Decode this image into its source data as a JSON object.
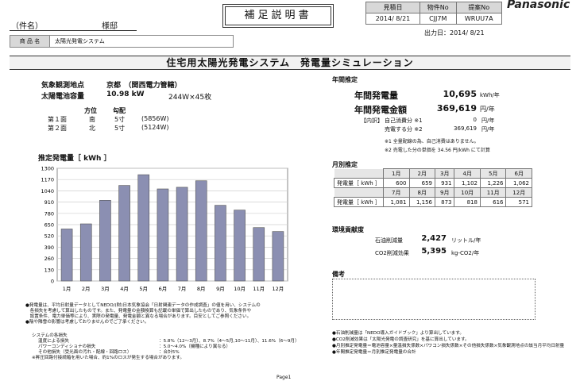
{
  "header": {
    "customer_label": "（件名）",
    "customer_suffix": "様邸",
    "product_label": "商 品 名",
    "product_value": "太陽光発電システム",
    "doc_title": "補足説明書",
    "meta_headers": [
      "見積日",
      "物件No",
      "提案No"
    ],
    "meta_values": [
      "2014/ 8/21",
      "CJJ7M",
      "WRUU7A"
    ],
    "output_date": "出力日：2014/ 8/21",
    "brand": "Panasonic"
  },
  "main_title": "住宅用太陽光発電システム　発電量シミュレーション",
  "site": {
    "location_label": "気象観測地点",
    "location_value": "京都　（関西電力管轄）",
    "capacity_label": "太陽電池容量",
    "capacity_value": "10.98 kW",
    "panels": "244W×45枚",
    "col_direction": "方位",
    "col_pitch": "勾配",
    "faces": [
      {
        "name": "第１面",
        "direction": "南",
        "pitch": "5寸",
        "watt": "(5856W)"
      },
      {
        "name": "第２面",
        "direction": "北",
        "pitch": "5寸",
        "watt": "(5124W)"
      }
    ]
  },
  "chart_data": {
    "type": "bar",
    "title": "推定発電量［ kWh ］",
    "categories": [
      "1月",
      "2月",
      "3月",
      "4月",
      "5月",
      "6月",
      "7月",
      "8月",
      "9月",
      "10月",
      "11月",
      "12月"
    ],
    "values": [
      600,
      659,
      931,
      1102,
      1226,
      1062,
      1081,
      1156,
      873,
      818,
      616,
      571
    ],
    "ylim": [
      0,
      1300
    ],
    "yticks": [
      "0",
      "130",
      "260",
      "390",
      "520",
      "650",
      "780",
      "910",
      "1040",
      "1170",
      "1300"
    ],
    "bar_color": "#8b8fb2",
    "grid": true
  },
  "annual": {
    "section_title": "年間推定",
    "gen_label": "年間発電量",
    "gen_value": "10,695",
    "gen_unit": "kWh/年",
    "amount_label": "年間発電金額",
    "amount_value": "369,619",
    "amount_unit": "円/年",
    "breakdown_tag": "【内訳】",
    "self_label": "自己消費分 ※1",
    "self_value": "0",
    "self_unit": "円/年",
    "sell_label": "売電する分 ※2",
    "sell_value": "369,619",
    "sell_unit": "円/年",
    "note1": "※1 全量配線の為、自己消費はありません。",
    "note2": "※2 売電した分の単価を 34.56 円/kWh にて計算"
  },
  "monthly": {
    "section_title": "月別推定",
    "row_label": "発電量［ kWh ］",
    "months_a": [
      "1月",
      "2月",
      "3月",
      "4月",
      "5月",
      "6月"
    ],
    "values_a": [
      "600",
      "659",
      "931",
      "1,102",
      "1,226",
      "1,062"
    ],
    "months_b": [
      "7月",
      "8月",
      "9月",
      "10月",
      "11月",
      "12月"
    ],
    "values_b": [
      "1,081",
      "1,156",
      "873",
      "818",
      "616",
      "571"
    ]
  },
  "environment": {
    "section_title": "環境貢献度",
    "oil_label": "石油削減量",
    "oil_value": "2,427",
    "oil_unit": "リットル/年",
    "co2_label": "CO2削減効果",
    "co2_value": "5,395",
    "co2_unit": "kg-CO2/年"
  },
  "remarks": {
    "section_title": "備考"
  },
  "notes_left": {
    "p1": "●発電量は、平均日射量データとしてNEDO/(財)日本気象協会「日射関連データの作成調査」の値を用い、システムの",
    "p2": "　各損失を考慮して算出したものです。また、発電量の金額換算も記載の単価で算出したものであり、気象条件や",
    "p3": "　設置条件、電力単価等により、実際の発電量、発電金額と異なる場合があります。目安としてご参照ください。",
    "p4": "●陰や隣雪の影響は考慮しておりませんのでご了承ください。",
    "loss_title": "システムの各損失",
    "loss1_label": "温度による損失",
    "loss1_value": "：5.8%（12〜3月）、8.7%（4〜5月,10〜11月）、11.6%（6〜9月）",
    "loss2_label": "パワーコンディショナの損失",
    "loss2_value": "：5.0〜4.0%（機種により異なる）",
    "loss3_label": "その他損失（受光面の汚れ・配線・回路ロス）",
    "loss3_value": "：合計5%",
    "loss_note": "※昇圧回路付接続箱を用いた場合、約1%のロスが発生する場合があります。"
  },
  "notes_right": {
    "n1": "●石油削減量は「NEDO導入ガイドブック」より算出しています。",
    "n2": "●CO2削減効果は「太陽光発電の調査研究」を基に算出しています。",
    "n3": "●月別推定発電量＝電池容量×量温損失係数×パワコン損失係数×その他損失係数×気象観測地点の該当月平均日射量",
    "n4": "●年間推定発電量＝月別推定発電量の合計"
  },
  "footer": {
    "page": "Page1"
  }
}
